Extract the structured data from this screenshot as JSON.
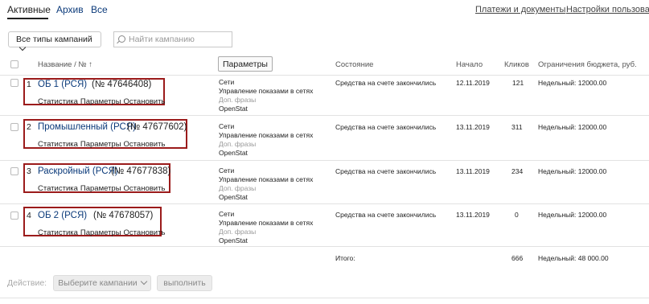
{
  "tabs": [
    {
      "label": "Активные"
    },
    {
      "label": "Архив"
    },
    {
      "label": "Все"
    }
  ],
  "top_links": {
    "payments": "Платежи и документы",
    "settings": "Настройки пользовате"
  },
  "filters": {
    "campaign_type": "Все типы кампаний",
    "search_placeholder": "Найти кампанию"
  },
  "table": {
    "headers": {
      "name": "Название / № ↑",
      "params_button": "Параметры",
      "state": "Состояние",
      "start": "Начало",
      "clicks": "Кликов",
      "budget": "Ограничения бюджета, руб."
    },
    "rows": [
      {
        "num": "1",
        "name": "ОБ 1 (РСЯ)",
        "id": "(№ 47646408)",
        "actions": [
          "Статистика",
          "Параметры",
          "Остановить"
        ],
        "params": [
          "Сети",
          "Управление показами в сетях",
          "Доп. фразы",
          "OpenStat"
        ],
        "state": "Средства на счете закончились",
        "start": "12.11.2019",
        "clicks": "121",
        "budget": "Недельный: 12000.00"
      },
      {
        "num": "2",
        "name": "Промышленный (РСЯ)",
        "id": "(№ 47677602)",
        "actions": [
          "Статистика",
          "Параметры",
          "Остановить"
        ],
        "params": [
          "Сети",
          "Управление показами в сетях",
          "Доп. фразы",
          "OpenStat"
        ],
        "state": "Средства на счете закончились",
        "start": "13.11.2019",
        "clicks": "311",
        "budget": "Недельный: 12000.00"
      },
      {
        "num": "3",
        "name": "Раскройный (РСЯ)",
        "id": "(№ 47677838)",
        "actions": [
          "Статистика",
          "Параметры",
          "Остановить"
        ],
        "params": [
          "Сети",
          "Управление показами в сетях",
          "Доп. фразы",
          "OpenStat"
        ],
        "state": "Средства на счете закончились",
        "start": "13.11.2019",
        "clicks": "234",
        "budget": "Недельный: 12000.00"
      },
      {
        "num": "4",
        "name": "ОБ 2 (РСЯ)",
        "id": "(№ 47678057)",
        "actions": [
          "Статистика",
          "Параметры",
          "Остановить"
        ],
        "params": [
          "Сети",
          "Управление показами в сетях",
          "Доп. фразы",
          "OpenStat"
        ],
        "state": "Средства на счете закончились",
        "start": "13.11.2019",
        "clicks": "0",
        "budget": "Недельный: 12000.00"
      }
    ],
    "total": {
      "label": "Итого:",
      "clicks": "666",
      "budget": "Недельный: 48 000.00"
    }
  },
  "footer": {
    "action_label": "Действие:",
    "select_campaigns": "Выберите кампании",
    "execute": "выполнить"
  },
  "colors": {
    "link": "#0b3a7a",
    "highlight_box": "#9b1b1b"
  }
}
